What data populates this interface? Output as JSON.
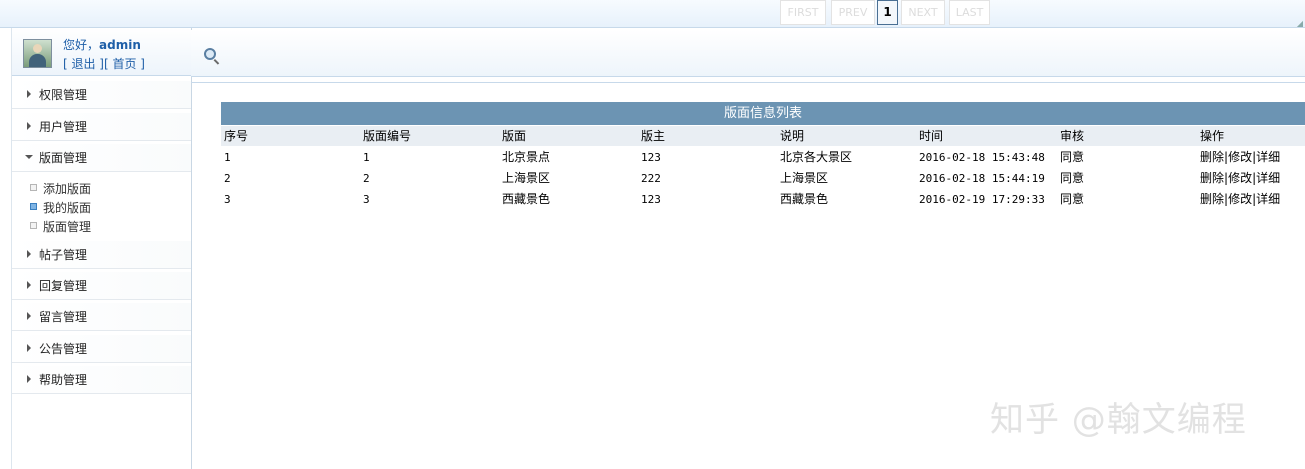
{
  "user": {
    "greeting": "您好，",
    "name": "admin",
    "logout": "[ 退出 ]",
    "home": "[ 首页 ]"
  },
  "sidebar": {
    "items": [
      {
        "label": "权限管理"
      },
      {
        "label": "用户管理"
      },
      {
        "label": "版面管理"
      },
      {
        "label": "帖子管理"
      },
      {
        "label": "回复管理"
      },
      {
        "label": "留言管理"
      },
      {
        "label": "公告管理"
      },
      {
        "label": "帮助管理"
      }
    ],
    "sub_items": [
      {
        "label": "添加版面"
      },
      {
        "label": "我的版面"
      },
      {
        "label": "版面管理"
      }
    ]
  },
  "table": {
    "title": "版面信息列表",
    "headers": [
      "序号",
      "版面编号",
      "版面",
      "版主",
      "说明",
      "时间",
      "审核",
      "操作"
    ],
    "rows": [
      {
        "index": "1",
        "code": "1",
        "name": "北京景点",
        "moderator": "123",
        "desc": "北京各大景区",
        "time": "2016-02-18 15:43:48",
        "audit": "同意"
      },
      {
        "index": "2",
        "code": "2",
        "name": "上海景区",
        "moderator": "222",
        "desc": "上海景区",
        "time": "2016-02-18 15:44:19",
        "audit": "同意"
      },
      {
        "index": "3",
        "code": "3",
        "name": "西藏景色",
        "moderator": "123",
        "desc": "西藏景色",
        "time": "2016-02-19 17:29:33",
        "audit": "同意"
      }
    ],
    "actions": {
      "delete": "删除",
      "edit": "修改",
      "detail": "详细",
      "sep": "|"
    }
  },
  "pager": {
    "first": "FIRST",
    "prev": "PREV",
    "current": "1",
    "next": "NEXT",
    "last": "LAST"
  },
  "watermark": "知乎 @翰文编程"
}
